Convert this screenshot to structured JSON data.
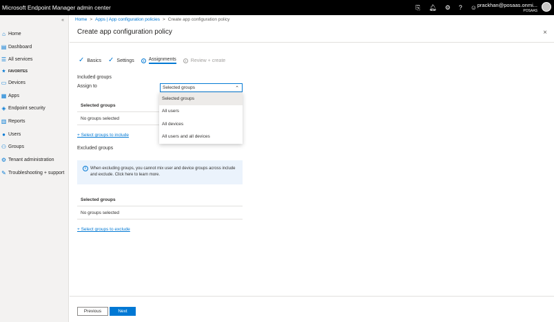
{
  "app": {
    "title": "Microsoft Endpoint Manager admin center",
    "user_email": "prackhan@posaas.onmi...",
    "user_tenant": "POSAAS",
    "icons": [
      "feedback-icon",
      "bell-icon",
      "gear-icon",
      "help-icon",
      "smiley-icon"
    ]
  },
  "sidebar": {
    "collapse": "«",
    "items": [
      {
        "label": "Home",
        "icon": "home-icon",
        "glyph": "⌂"
      },
      {
        "label": "Dashboard",
        "icon": "dashboard-icon",
        "glyph": "▤"
      },
      {
        "label": "All services",
        "icon": "all-services-icon",
        "glyph": "☰"
      },
      {
        "label": "FAVORITES",
        "icon": "star-icon",
        "glyph": "★"
      },
      {
        "label": "Devices",
        "icon": "devices-icon",
        "glyph": "▭"
      },
      {
        "label": "Apps",
        "icon": "apps-icon",
        "glyph": "▦"
      },
      {
        "label": "Endpoint security",
        "icon": "endpoint-security-icon",
        "glyph": "◈"
      },
      {
        "label": "Reports",
        "icon": "reports-icon",
        "glyph": "▥"
      },
      {
        "label": "Users",
        "icon": "users-icon",
        "glyph": "●"
      },
      {
        "label": "Groups",
        "icon": "groups-icon",
        "glyph": "⚇"
      },
      {
        "label": "Tenant administration",
        "icon": "tenant-admin-icon",
        "glyph": "⚙"
      },
      {
        "label": "Troubleshooting + support",
        "icon": "troubleshooting-icon",
        "glyph": "✎"
      }
    ]
  },
  "breadcrumb": {
    "home": "Home",
    "sep": ">",
    "apps": "Apps | App configuration policies",
    "current": "Create app configuration policy"
  },
  "page": {
    "title": "Create app configuration policy",
    "close": "×"
  },
  "steps": [
    {
      "label": "Basics",
      "state": "done"
    },
    {
      "label": "Settings",
      "state": "done"
    },
    {
      "label": "Assignments",
      "state": "active",
      "num": "3"
    },
    {
      "label": "Review + create",
      "state": "disabled",
      "num": "4"
    }
  ],
  "included": {
    "heading": "Included groups",
    "assign_to_label": "Assign to",
    "dropdown_value": "Selected groups",
    "options": [
      "Selected groups",
      "All users",
      "All devices",
      "All users and all devices"
    ],
    "table_header": "Selected groups",
    "empty": "No groups selected",
    "add_link": "+ Select groups to include"
  },
  "excluded": {
    "heading": "Excluded groups",
    "info": "When excluding groups, you cannot mix user and device groups across include and exclude.  Click here to learn more.",
    "info_icon": "i",
    "table_header": "Selected groups",
    "empty": "No groups selected",
    "add_link": "+ Select groups to exclude"
  },
  "footer": {
    "previous": "Previous",
    "next": "Next"
  },
  "colors": {
    "accent": "#0078d4",
    "topbar": "#000000",
    "sidebar": "#f3f2f1"
  }
}
